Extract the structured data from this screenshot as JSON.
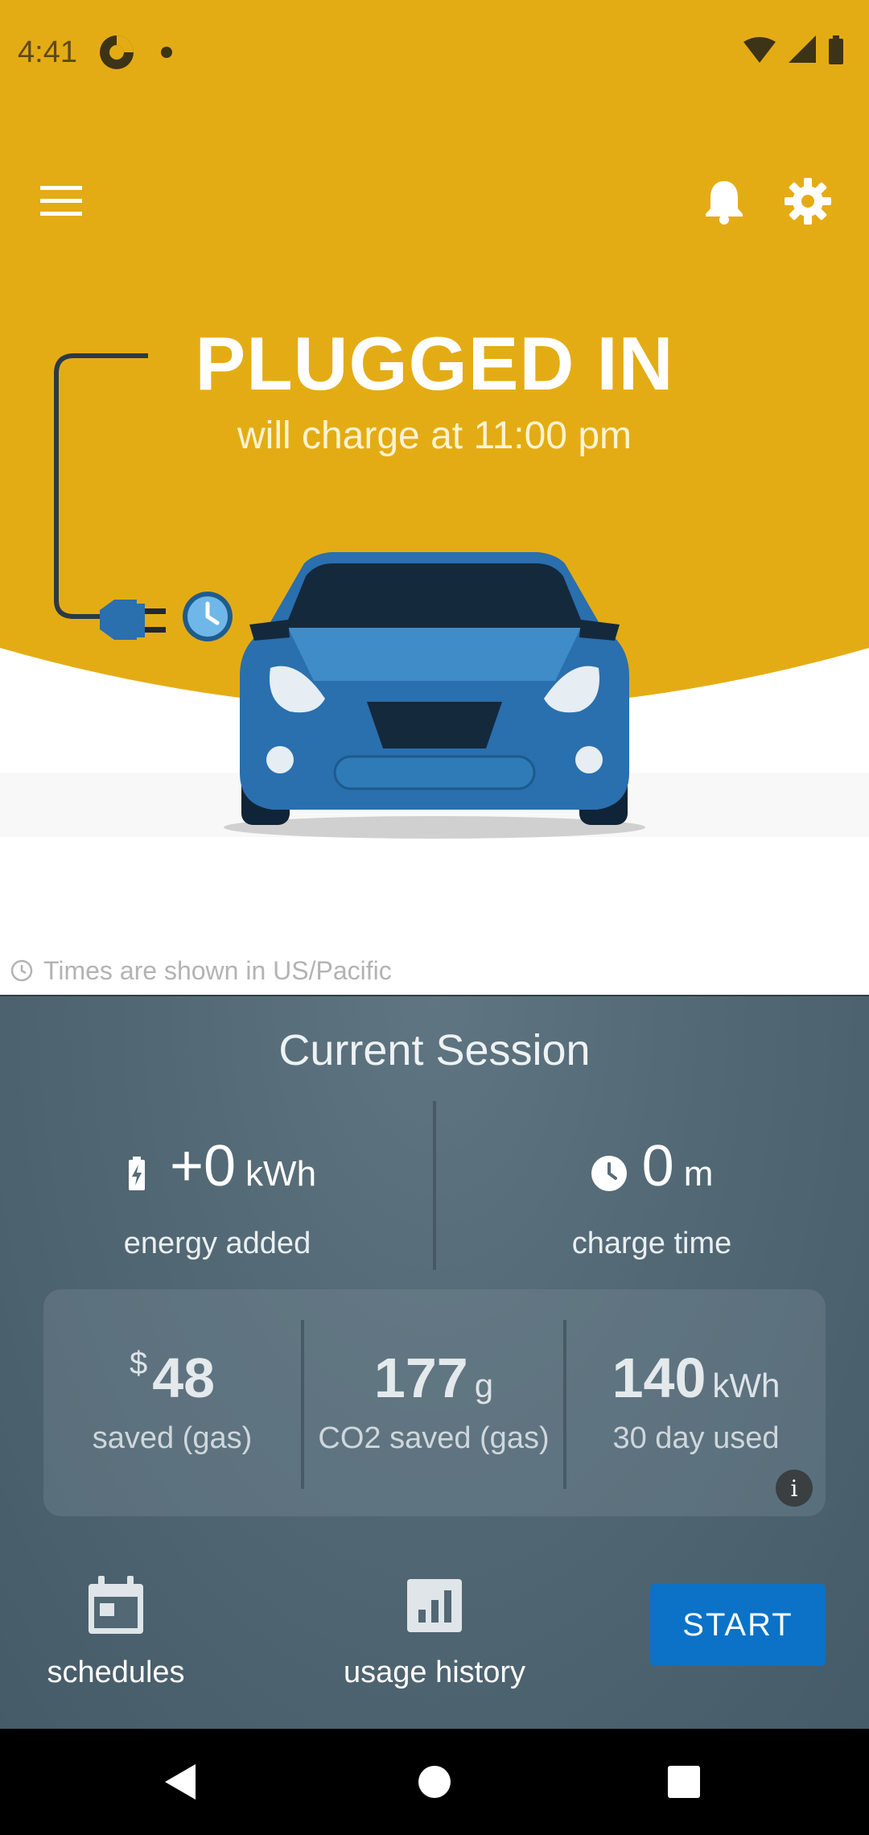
{
  "status_bar": {
    "time": "4:41"
  },
  "header": {
    "status_title": "PLUGGED IN",
    "status_subtitle": "will charge at 11:00 pm"
  },
  "timezone_note": "Times are shown in US/Pacific",
  "session": {
    "title": "Current Session",
    "energy": {
      "value": "+0",
      "unit": "kWh",
      "label": "energy added"
    },
    "charge_time": {
      "value": "0",
      "unit": "m",
      "label": "charge time"
    }
  },
  "savings": {
    "money": {
      "prefix": "$",
      "value": "48",
      "label": "saved (gas)"
    },
    "co2": {
      "value": "177",
      "unit": "g",
      "label": "CO2 saved (gas)"
    },
    "usage": {
      "value": "140",
      "unit": "kWh",
      "label": "30 day used"
    },
    "info_icon_text": "i"
  },
  "bottom_nav": {
    "schedules_label": "schedules",
    "usage_history_label": "usage history",
    "start_label": "START"
  },
  "colors": {
    "amber": "#E4AC14",
    "panel": "#526874",
    "start_button": "#0B72C7",
    "car_blue": "#2A6FAE"
  }
}
